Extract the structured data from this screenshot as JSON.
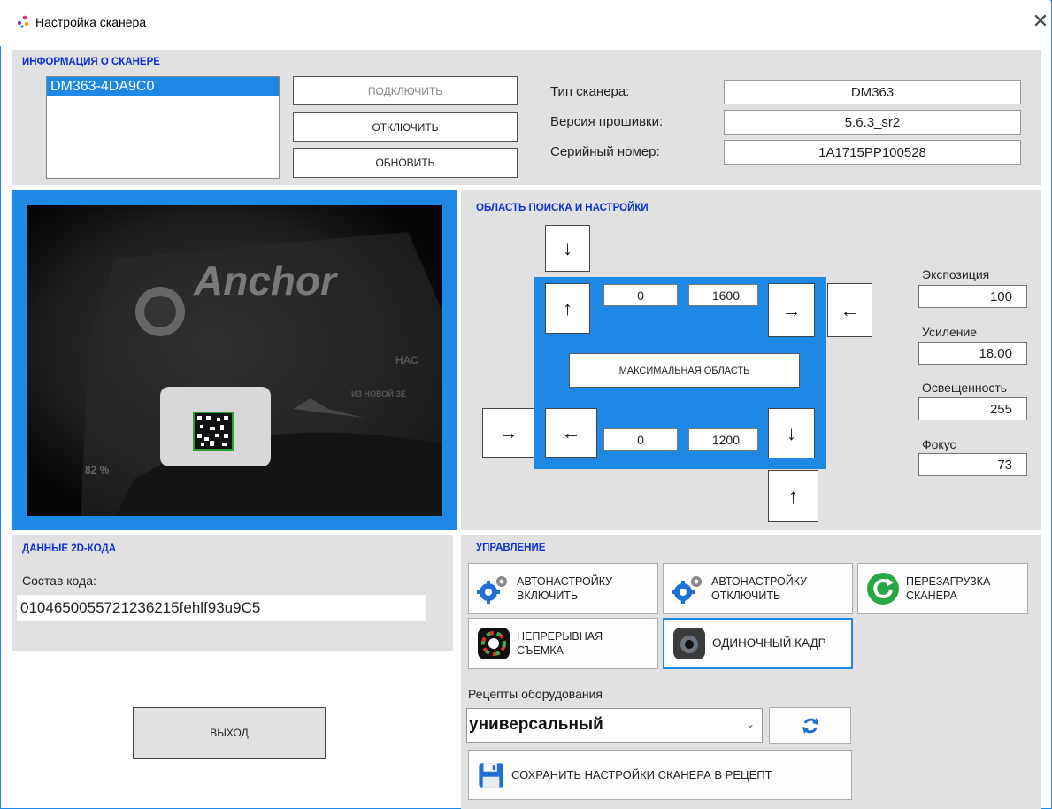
{
  "window": {
    "title": "Настройка сканера"
  },
  "scanner_info": {
    "section_title": "ИНФОРМАЦИЯ О СКАНЕРЕ",
    "devices": [
      "DM363-4DA9C0"
    ],
    "connect_label": "ПОДКЛЮЧИТЬ",
    "disconnect_label": "ОТКЛЮЧИТЬ",
    "refresh_label": "ОБНОВИТЬ",
    "type_label": "Тип сканера:",
    "type_value": "DM363",
    "firmware_label": "Версия прошивки:",
    "firmware_value": "5.6.3_sr2",
    "serial_label": "Серийный номер:",
    "serial_value": "1A1715PP100528"
  },
  "preview": {
    "logo_text": "Anchor",
    "percent_text": "82 %",
    "side_text_1": "НАС",
    "side_text_2": "ИЗ НОВОЙ ЗЕ"
  },
  "search_area": {
    "section_title": "ОБЛАСТЬ ПОИСКА И НАСТРОЙКИ",
    "top_left": "0",
    "top_right": "1600",
    "bottom_left": "0",
    "bottom_right": "1200",
    "max_area_label": "МАКСИМАЛЬНАЯ ОБЛАСТЬ",
    "arrows": {
      "down": "↓",
      "up": "↑",
      "right": "→",
      "left": "←"
    }
  },
  "settings": {
    "exposure_label": "Экспозиция",
    "exposure_value": "100",
    "gain_label": "Усиление",
    "gain_value": "18.00",
    "light_label": "Освещенность",
    "light_value": "255",
    "focus_label": "Фокус",
    "focus_value": "73"
  },
  "code_data": {
    "section_title": "ДАННЫЕ 2D-КОДА",
    "content_label": "Состав кода:",
    "content_value": "010465005572123621 5fehlf93u9C5",
    "content_value_display": "0104650055721236215fehlf93u9C5"
  },
  "exit_label": "ВЫХОД",
  "control": {
    "section_title": "УПРАВЛЕНИЕ",
    "auto_on_label": "АВТОНАСТРОЙКУ ВКЛЮЧИТЬ",
    "auto_off_label": "АВТОНАСТРОЙКУ ОТКЛЮЧИТЬ",
    "reboot_label": "ПЕРЕЗАГРУЗКА СКАНЕРА",
    "continuous_label": "НЕПРЕРЫВНАЯ СЪЕМКА",
    "single_label": "ОДИНОЧНЫЙ КАДР",
    "recipes_label": "Рецепты оборудования",
    "recipe_selected": "универсальный",
    "save_label": "СОХРАНИТЬ НАСТРОЙКИ СКАНЕРА В РЕЦЕПТ"
  },
  "colors": {
    "accent": "#1e88e5",
    "section_title": "#0a2fd6",
    "panel": "#e1e1e1",
    "code_box": "#2aa02a"
  }
}
